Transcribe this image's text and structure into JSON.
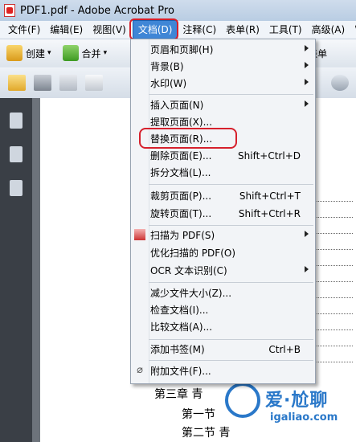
{
  "window": {
    "title": "PDF1.pdf - Adobe Acrobat Pro"
  },
  "menubar": [
    {
      "label": "文件(F)"
    },
    {
      "label": "编辑(E)"
    },
    {
      "label": "视图(V)"
    },
    {
      "label": "文档(D)",
      "active": true
    },
    {
      "label": "注释(C)"
    },
    {
      "label": "表单(R)"
    },
    {
      "label": "工具(T)"
    },
    {
      "label": "高级(A)"
    },
    {
      "label": "窗"
    }
  ],
  "toolbar": {
    "create_label": "创建",
    "combine_label": "合并",
    "form_label": "表单"
  },
  "document_menu": {
    "items": [
      {
        "label": "页眉和页脚(H)",
        "submenu": true
      },
      {
        "label": "背景(B)",
        "submenu": true
      },
      {
        "label": "水印(W)",
        "submenu": true
      },
      {
        "label": "插入页面(N)",
        "submenu": true
      },
      {
        "label": "提取页面(X)..."
      },
      {
        "label": "替换页面(R)...",
        "highlighted": true
      },
      {
        "label": "删除页面(E)...",
        "shortcut": "Shift+Ctrl+D"
      },
      {
        "label": "拆分文档(L)..."
      },
      {
        "label": "裁剪页面(P)...",
        "shortcut": "Shift+Ctrl+T"
      },
      {
        "label": "旋转页面(T)...",
        "shortcut": "Shift+Ctrl+R"
      },
      {
        "label": "扫描为 PDF(S)",
        "submenu": true
      },
      {
        "label": "优化扫描的 PDF(O)"
      },
      {
        "label": "OCR 文本识别(C)",
        "submenu": true
      },
      {
        "label": "减少文件大小(Z)..."
      },
      {
        "label": "检查文档(I)..."
      },
      {
        "label": "比较文档(A)..."
      },
      {
        "label": "添加书签(M)",
        "shortcut": "Ctrl+B"
      },
      {
        "label": "附加文件(F)..."
      }
    ]
  },
  "document_text": {
    "line1": "第三章  青",
    "line2": "第一节",
    "line3": "第二节  青"
  },
  "watermark": {
    "text": "爱·尬聊",
    "url": "igaliao.com"
  },
  "colors": {
    "highlight_red": "#d6202c",
    "menu_active": "#3f86d6"
  }
}
